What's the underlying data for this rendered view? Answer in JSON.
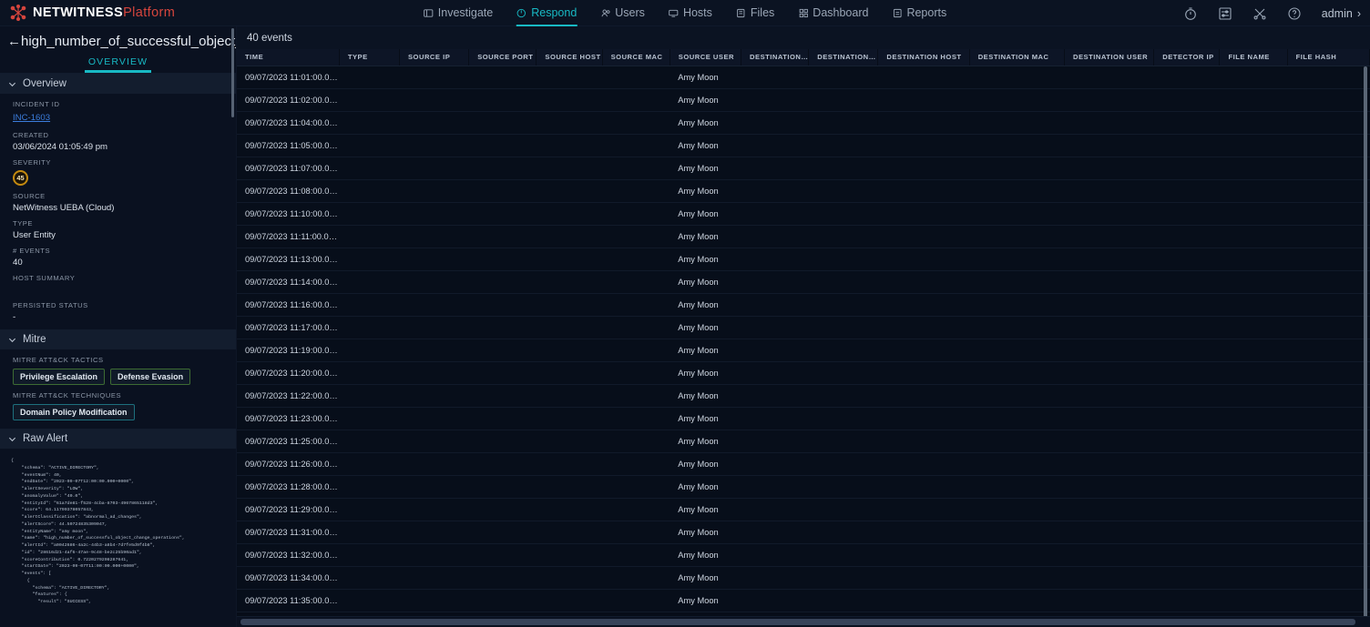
{
  "brand": {
    "part1": "NETWITNESS",
    "part2": "Platform",
    "logo_icon": "netwitness-logo-icon"
  },
  "nav": {
    "items": [
      {
        "label": "Investigate",
        "icon": "investigate-icon",
        "active": false
      },
      {
        "label": "Respond",
        "icon": "shield-icon",
        "active": true
      },
      {
        "label": "Users",
        "icon": "users-icon",
        "active": false
      },
      {
        "label": "Hosts",
        "icon": "hosts-icon",
        "active": false
      },
      {
        "label": "Files",
        "icon": "files-icon",
        "active": false
      },
      {
        "label": "Dashboard",
        "icon": "dashboard-icon",
        "active": false
      },
      {
        "label": "Reports",
        "icon": "reports-icon",
        "active": false
      }
    ],
    "right_icons": [
      "timer-icon",
      "sliders-icon",
      "tools-icon",
      "help-circle-icon"
    ],
    "user": "admin",
    "user_chevron": "›"
  },
  "sidebar": {
    "back_arrow": "←",
    "incident_title": "high_number_of_successful_object_change",
    "tab": "OVERVIEW",
    "sections": {
      "overview": {
        "header": "Overview",
        "fields": [
          {
            "label": "INCIDENT ID",
            "value": "INC-1603",
            "link": true
          },
          {
            "label": "CREATED",
            "value": "03/06/2024 01:05:49 pm"
          },
          {
            "label": "SEVERITY",
            "value": "45",
            "badge": true
          },
          {
            "label": "SOURCE",
            "value": "NetWitness UEBA (Cloud)"
          },
          {
            "label": "TYPE",
            "value": "User Entity"
          },
          {
            "label": "# EVENTS",
            "value": "40"
          },
          {
            "label": "HOST SUMMARY",
            "value": ""
          },
          {
            "label": "PERSISTED STATUS",
            "value": "-"
          }
        ]
      },
      "mitre": {
        "header": "Mitre",
        "tactics_label": "MITRE ATT&CK TACTICS",
        "tactics": [
          "Privilege Escalation",
          "Defense Evasion"
        ],
        "techniques_label": "MITRE ATT&CK TECHNIQUES",
        "techniques": [
          "Domain Policy Modification"
        ]
      },
      "raw_alert": {
        "header": "Raw Alert",
        "json": "{\n    \"schema\": \"ACTIVE_DIRECTORY\",\n    \"eventNum\": 40,\n    \"endDate\": \"2023-09-07T12:00:00.000+0000\",\n    \"alertSeverity\": \"LOW\",\n    \"anomalyValue\": \"40.0\",\n    \"entityId\": \"61a7de81-f528-4cba-8703-4967865118d3\",\n    \"score\": 64.11799378057843,\n    \"alertClassification\": \"abnormal_ad_changes\",\n    \"alertScore\": 44.50724835309047,\n    \"entityName\": \"amy moon\",\n    \"name\": \"high_number_of_successful_object_change_operations\",\n    \"alertId\": \"a0042686-4a2c-44b3-a8b4-7d7fe5d9f4b8\",\n    \"id\": \"28616d21-4af6-47ae-9c48-be2c25b90ad1\",\n    \"scoreContribution\": 0.7220279208287641,\n    \"startDate\": \"2023-09-07T11:00:00.000+0000\",\n    \"events\": [\n      {\n        \"schema\": \"ACTIVE_DIRECTORY\",\n        \"features\": {\n          \"result\": \"SUCCESS\","
      }
    }
  },
  "main": {
    "events_count": "40 events",
    "columns": [
      "TIME",
      "TYPE",
      "SOURCE IP",
      "SOURCE PORT",
      "SOURCE HOST",
      "SOURCE MAC",
      "SOURCE USER",
      "DESTINATION IP",
      "DESTINATION P...",
      "DESTINATION HOST",
      "DESTINATION MAC",
      "DESTINATION USER",
      "DETECTOR IP",
      "FILE NAME",
      "FILE HASH"
    ],
    "rows": [
      {
        "time": "09/07/2023 11:01:00.000...",
        "source_user": "Amy Moon"
      },
      {
        "time": "09/07/2023 11:02:00.000...",
        "source_user": "Amy Moon"
      },
      {
        "time": "09/07/2023 11:04:00.000...",
        "source_user": "Amy Moon"
      },
      {
        "time": "09/07/2023 11:05:00.000...",
        "source_user": "Amy Moon"
      },
      {
        "time": "09/07/2023 11:07:00.000...",
        "source_user": "Amy Moon"
      },
      {
        "time": "09/07/2023 11:08:00.000...",
        "source_user": "Amy Moon"
      },
      {
        "time": "09/07/2023 11:10:00.000...",
        "source_user": "Amy Moon"
      },
      {
        "time": "09/07/2023 11:11:00.000...",
        "source_user": "Amy Moon"
      },
      {
        "time": "09/07/2023 11:13:00.000...",
        "source_user": "Amy Moon"
      },
      {
        "time": "09/07/2023 11:14:00.000...",
        "source_user": "Amy Moon"
      },
      {
        "time": "09/07/2023 11:16:00.000...",
        "source_user": "Amy Moon"
      },
      {
        "time": "09/07/2023 11:17:00.000...",
        "source_user": "Amy Moon"
      },
      {
        "time": "09/07/2023 11:19:00.000...",
        "source_user": "Amy Moon"
      },
      {
        "time": "09/07/2023 11:20:00.000...",
        "source_user": "Amy Moon"
      },
      {
        "time": "09/07/2023 11:22:00.000...",
        "source_user": "Amy Moon"
      },
      {
        "time": "09/07/2023 11:23:00.000...",
        "source_user": "Amy Moon"
      },
      {
        "time": "09/07/2023 11:25:00.000...",
        "source_user": "Amy Moon"
      },
      {
        "time": "09/07/2023 11:26:00.000...",
        "source_user": "Amy Moon"
      },
      {
        "time": "09/07/2023 11:28:00.000...",
        "source_user": "Amy Moon"
      },
      {
        "time": "09/07/2023 11:29:00.000...",
        "source_user": "Amy Moon"
      },
      {
        "time": "09/07/2023 11:31:00.000...",
        "source_user": "Amy Moon"
      },
      {
        "time": "09/07/2023 11:32:00.000...",
        "source_user": "Amy Moon"
      },
      {
        "time": "09/07/2023 11:34:00.000...",
        "source_user": "Amy Moon"
      },
      {
        "time": "09/07/2023 11:35:00.000...",
        "source_user": "Amy Moon"
      }
    ]
  },
  "colors": {
    "accent": "#18b9c4",
    "brand_red": "#d6453d",
    "link": "#3b7ddd",
    "severity": "#c48a10"
  }
}
